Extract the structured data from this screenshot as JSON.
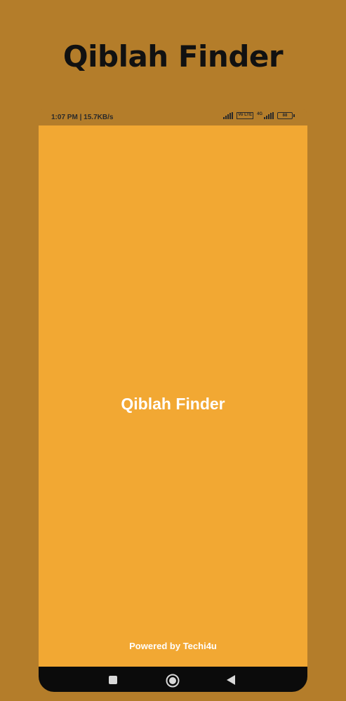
{
  "promo": {
    "title": "Qiblah Finder"
  },
  "status_bar": {
    "time": "1:07 PM",
    "separator": "|",
    "speed": "15.7KB/s",
    "volte_label": "Vo LTE",
    "network_label": "4G",
    "battery": "88"
  },
  "app": {
    "splash_title": "Qiblah Finder",
    "powered_by": "Powered by Techi4u",
    "background_color": "#F2A833"
  },
  "nav": {
    "icons": [
      "square-icon",
      "circle-home-icon",
      "triangle-back-icon"
    ]
  },
  "colors": {
    "page_background": "#B47D2A",
    "app_background": "#F2A833",
    "nav_background": "#0B0B0B",
    "text_white": "#FFFFFF"
  }
}
